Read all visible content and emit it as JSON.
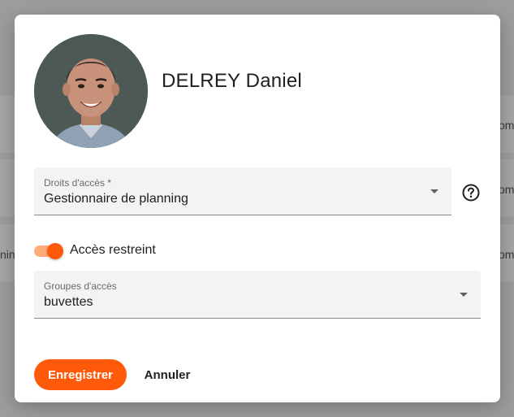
{
  "background": {
    "row_snippets": [
      "om",
      "om",
      "nin",
      "om"
    ]
  },
  "dialog": {
    "user_name": "DELREY Daniel",
    "access_rights": {
      "label": "Droits d'accès *",
      "value": "Gestionnaire de planning"
    },
    "restricted_toggle": {
      "label": "Accès restreint",
      "checked": true
    },
    "access_groups": {
      "label": "Groupes d'accès",
      "value": "buvettes"
    },
    "actions": {
      "save_label": "Enregistrer",
      "cancel_label": "Annuler"
    }
  },
  "colors": {
    "accent": "#ff5a0a",
    "accent_light": "#ffab7a",
    "field_bg": "#f3f3f3"
  },
  "icons": {
    "help": "help-circle-icon",
    "dropdown": "chevron-down-icon"
  }
}
